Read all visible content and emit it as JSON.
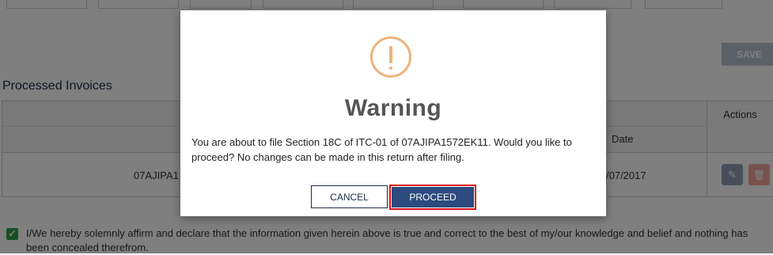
{
  "page": {
    "save_label": "SAVE",
    "section_title": "Processed Invoices",
    "table": {
      "actions_header": "Actions",
      "date_header": "Date",
      "row": {
        "gstin_partial": "07AJIPA1",
        "date_partial": "/07/2017"
      }
    },
    "declaration": "I/We hereby solemnly affirm and declare that the information given herein above is true and correct to the best of my/our knowledge and belief and nothing has been concealed therefrom.",
    "declaration_checked": true
  },
  "modal": {
    "title": "Warning",
    "message": "You are about to file Section 18C of ITC-01 of 07AJIPA1572EK11. Would you like to proceed? No changes can be made in this return after filing.",
    "cancel_label": "CANCEL",
    "proceed_label": "PROCEED"
  },
  "colors": {
    "primary": "#2c4a7e",
    "highlight_border": "#d8141a",
    "warning_icon": "#f0b27a",
    "check": "#2e9e44"
  },
  "icons": {
    "warning": "exclamation-circle-icon",
    "edit": "pencil-icon",
    "delete": "trash-icon",
    "checkbox": "checkmark-icon"
  }
}
